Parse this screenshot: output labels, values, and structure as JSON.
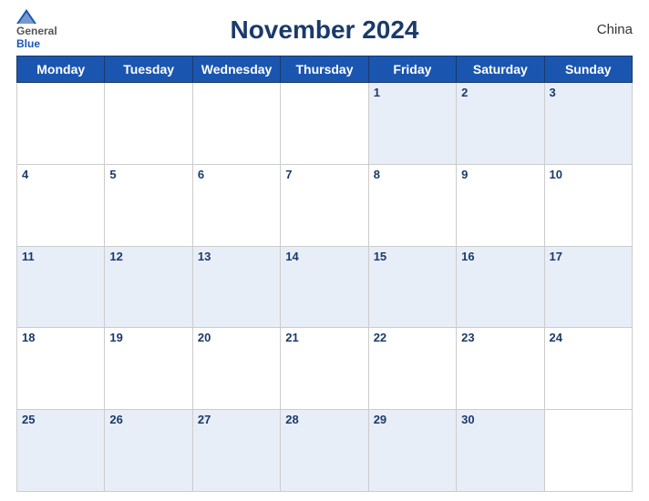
{
  "header": {
    "logo_general": "General",
    "logo_blue": "Blue",
    "title": "November 2024",
    "country": "China"
  },
  "days_of_week": [
    "Monday",
    "Tuesday",
    "Wednesday",
    "Thursday",
    "Friday",
    "Saturday",
    "Sunday"
  ],
  "weeks": [
    [
      null,
      null,
      null,
      null,
      1,
      2,
      3
    ],
    [
      4,
      5,
      6,
      7,
      8,
      9,
      10
    ],
    [
      11,
      12,
      13,
      14,
      15,
      16,
      17
    ],
    [
      18,
      19,
      20,
      21,
      22,
      23,
      24
    ],
    [
      25,
      26,
      27,
      28,
      29,
      30,
      null
    ]
  ]
}
